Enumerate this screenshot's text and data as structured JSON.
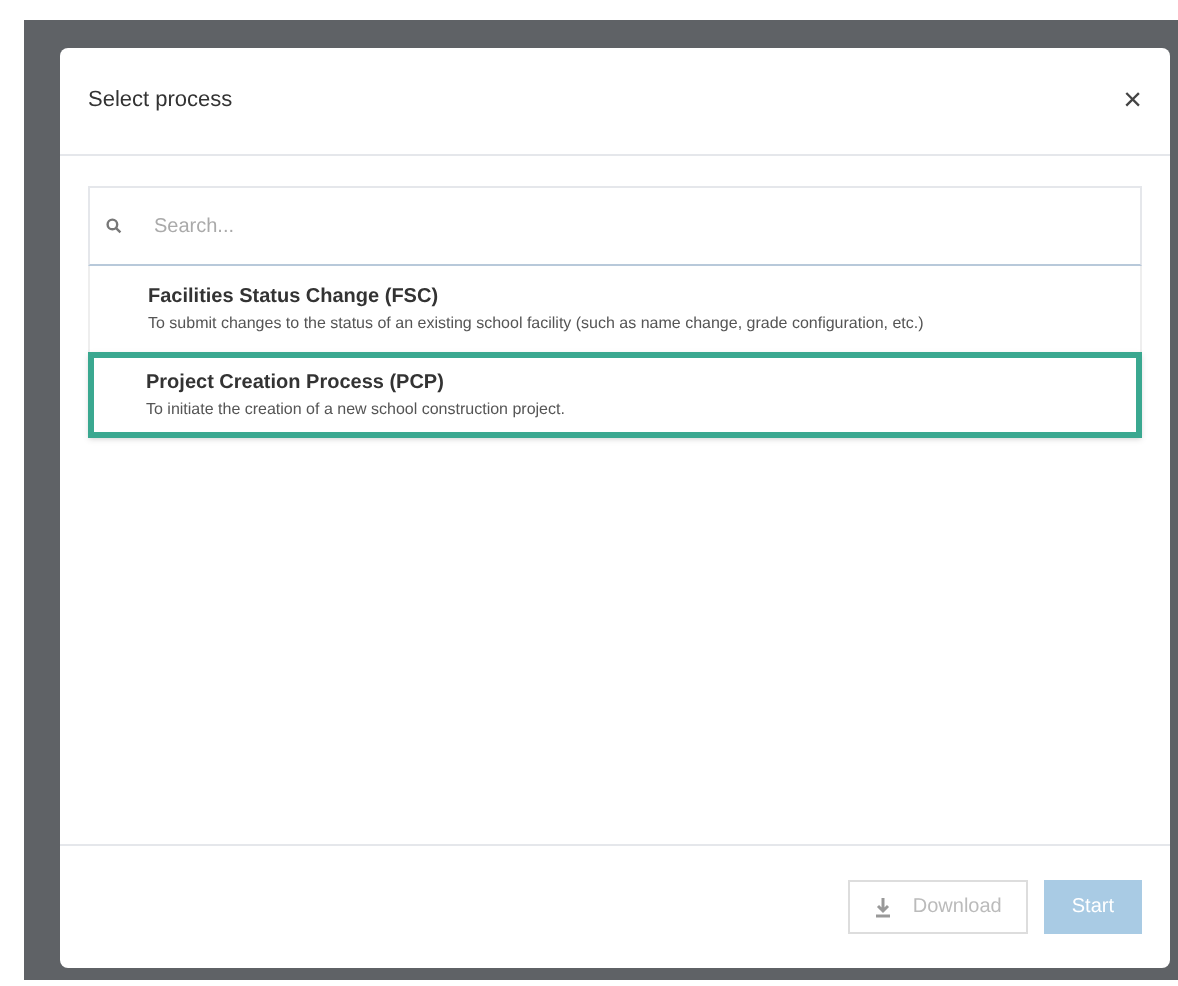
{
  "dialog": {
    "title": "Select process",
    "close": "×"
  },
  "search": {
    "placeholder": "Search..."
  },
  "processes": [
    {
      "name": "Facilities Status Change (FSC)",
      "description": "To submit changes to the status of an existing school facility (such as name change, grade configuration, etc.)",
      "selected": false
    },
    {
      "name": "Project Creation Process (PCP)",
      "description": "To initiate the creation of a new school construction project.",
      "selected": true
    }
  ],
  "buttons": [
    {
      "kind": "download",
      "label": "Download",
      "disabled": true
    },
    {
      "kind": "start",
      "label": "Start",
      "disabled": true
    }
  ]
}
